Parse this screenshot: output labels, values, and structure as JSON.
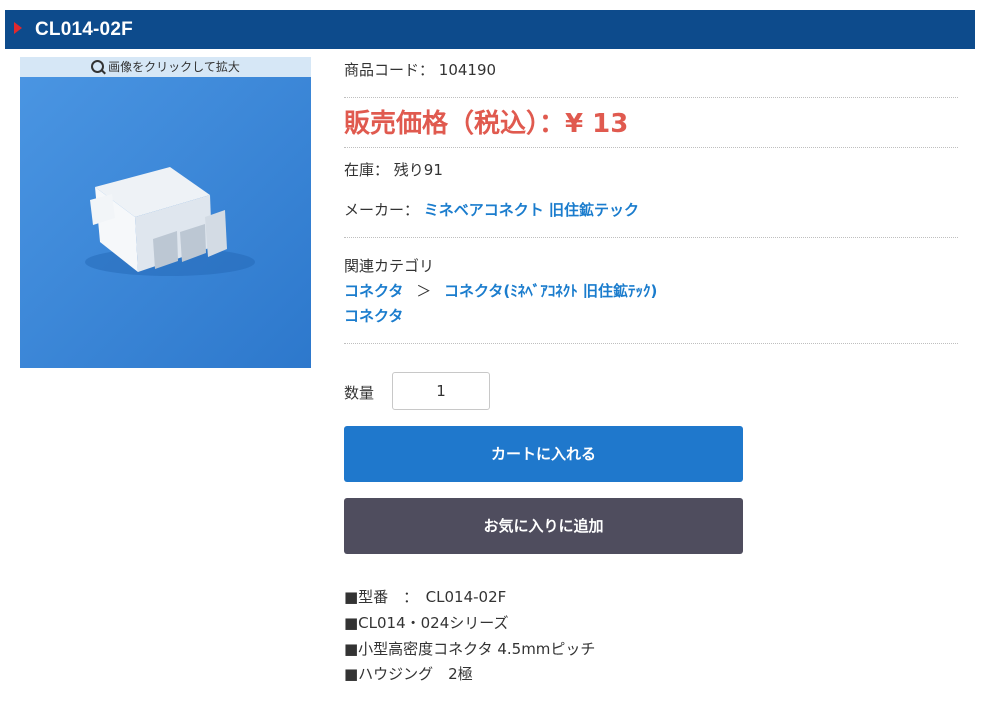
{
  "product": {
    "title": "CL014-02F",
    "zoom_label": "画像をクリックして拡大",
    "code_label": "商品コード：",
    "code": "104190",
    "price_text": "販売価格（税込）：¥ 13",
    "stock_label": "在庫：",
    "stock": "残り91",
    "maker_label": "メーカー：",
    "maker": "ミネベアコネクト 旧住鉱テック",
    "category_label": "関連カテゴリ",
    "category_path": [
      "コネクタ",
      "＞",
      "コネクタ(ﾐﾈﾍﾞｱｺﾈｸﾄ 旧住鉱ﾃｯｸ)"
    ],
    "category_second": "コネクタ",
    "quantity_label": "数量",
    "quantity": "1",
    "cart_button": "カートに入れる",
    "favorite_button": "お気に入りに追加",
    "specs": [
      "■型番　：　CL014-02F",
      "■CL014・024シリーズ",
      "■小型高密度コネクタ 4.5mmピッチ",
      "■ハウジング　2極"
    ]
  },
  "colors": {
    "title_bar": "#0d4b8c",
    "price": "#e05a4f",
    "link": "#1a7ccd",
    "cart_button": "#1f78cc",
    "favorite_button": "#4f4d5e",
    "photo_background": "#3a86d9"
  }
}
